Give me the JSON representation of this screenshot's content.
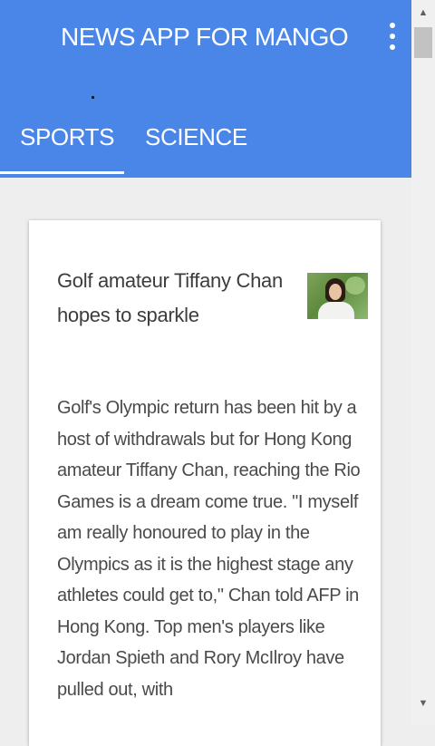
{
  "app": {
    "title": "NEWS APP FOR MANGO",
    "accent_color": "#4a86e8",
    "menu_icon": "overflow-menu-icon"
  },
  "tabs": [
    {
      "label": "SPORTS",
      "selected": true
    },
    {
      "label": "SCIENCE",
      "selected": false
    }
  ],
  "article": {
    "headline": "Golf amateur Tiffany Chan hopes to sparkle",
    "thumbnail": "photo of a smiling woman outdoors",
    "body": "Golf's Olympic return has been hit by a host of withdrawals but for Hong Kong amateur Tiffany Chan, reaching the Rio Games is a dream come true. \"I myself am really honoured to play in the Olympics as it is the highest stage any athletes could get to,\" Chan told AFP in Hong Kong. Top men's players like Jordan Spieth and Rory McIlroy have pulled out, with"
  },
  "scrollbar": {
    "up_icon": "scroll-up-arrow-icon",
    "down_icon": "scroll-down-arrow-icon",
    "up_glyph": "▲",
    "down_glyph": "▼"
  }
}
